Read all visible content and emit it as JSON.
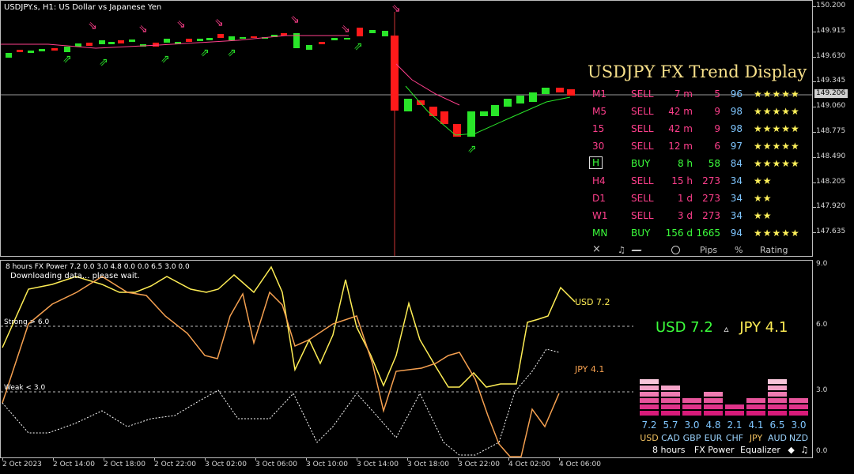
{
  "chart_title": "USDJPY.s, H1:  US Dollar vs Japanese Yen",
  "price_axis": [
    "150.200",
    "149.915",
    "149.630",
    "149.345",
    "149.060",
    "148.775",
    "148.490",
    "148.205",
    "147.920",
    "147.635"
  ],
  "current_price": "149.206",
  "trend": {
    "title": "USDJPY FX Trend Display",
    "rows": [
      {
        "tf": "M1",
        "signal": "SELL",
        "dur": "7 m",
        "pips": "5",
        "pct": "96",
        "stars": "★★★★★",
        "buy": false
      },
      {
        "tf": "M5",
        "signal": "SELL",
        "dur": "42 m",
        "pips": "9",
        "pct": "98",
        "stars": "★★★★★",
        "buy": false
      },
      {
        "tf": "15",
        "signal": "SELL",
        "dur": "42 m",
        "pips": "9",
        "pct": "98",
        "stars": "★★★★★",
        "buy": false
      },
      {
        "tf": "30",
        "signal": "SELL",
        "dur": "12 m",
        "pips": "6",
        "pct": "97",
        "stars": "★★★★★",
        "buy": false
      },
      {
        "tf": "H",
        "signal": "BUY",
        "dur": "8 h",
        "pips": "58",
        "pct": "84",
        "stars": "★★★★★",
        "buy": true
      },
      {
        "tf": "H4",
        "signal": "SELL",
        "dur": "15 h",
        "pips": "273",
        "pct": "34",
        "stars": "★★",
        "buy": false
      },
      {
        "tf": "D1",
        "signal": "SELL",
        "dur": "1 d",
        "pips": "273",
        "pct": "34",
        "stars": "★★",
        "buy": false
      },
      {
        "tf": "W1",
        "signal": "SELL",
        "dur": "3 d",
        "pips": "273",
        "pct": "34",
        "stars": "★★",
        "buy": false
      },
      {
        "tf": "MN",
        "signal": "BUY",
        "dur": "156 d",
        "pips": "1665",
        "pct": "94",
        "stars": "★★★★★",
        "buy": true
      }
    ],
    "header": {
      "close": "×",
      "music": "♫",
      "pips": "Pips",
      "pct": "%",
      "rating": "Rating"
    }
  },
  "indicator": {
    "title": "8 hours FX Power 7.2 0.0 3.0 4.8 0.0 0.0 6.5 3.0 0.0",
    "status": "Downloading data... please wait.",
    "strong_label": "Strong > 6.0",
    "weak_label": "Weak < 3.0",
    "axis": [
      "9.0",
      "6.0",
      "3.0",
      "0.0"
    ],
    "usd_label": "USD 7.2",
    "jpy_label": "JPY 4.1",
    "readout_usd": "USD 7.2",
    "readout_sep": "▵",
    "readout_jpy": "JPY 4.1",
    "equalizer": [
      {
        "cur": "USD",
        "val": "7.2",
        "level": 7.2,
        "color": "#f0c060"
      },
      {
        "cur": "CAD",
        "val": "5.7",
        "level": 5.7,
        "color": "#9bd4ff"
      },
      {
        "cur": "GBP",
        "val": "3.0",
        "level": 3.0,
        "color": "#9bd4ff"
      },
      {
        "cur": "EUR",
        "val": "4.8",
        "level": 4.8,
        "color": "#9bd4ff"
      },
      {
        "cur": "CHF",
        "val": "2.1",
        "level": 2.1,
        "color": "#9bd4ff"
      },
      {
        "cur": "JPY",
        "val": "4.1",
        "level": 4.1,
        "color": "#f0c060"
      },
      {
        "cur": "AUD",
        "val": "6.5",
        "level": 6.5,
        "color": "#9bd4ff"
      },
      {
        "cur": "NZD",
        "val": "3.0",
        "level": 3.0,
        "color": "#9bd4ff"
      }
    ],
    "footer": {
      "period": "8 hours",
      "name": "FX Power",
      "eq": "Equalizer",
      "nav": "◆",
      "music": "♫"
    }
  },
  "time_axis": [
    "2 Oct 2023",
    "2 Oct 14:00",
    "2 Oct 18:00",
    "2 Oct 22:00",
    "3 Oct 02:00",
    "3 Oct 06:00",
    "3 Oct 10:00",
    "3 Oct 14:00",
    "3 Oct 18:00",
    "3 Oct 22:00",
    "4 Oct 02:00",
    "4 Oct 06:00"
  ],
  "colors": {
    "bull": "#29e529",
    "bear": "#ff1a1a",
    "usd": "#ffee55",
    "jpy": "#f5a050",
    "weak_line": "#ffffff",
    "pink": "#ff3f8c"
  }
}
